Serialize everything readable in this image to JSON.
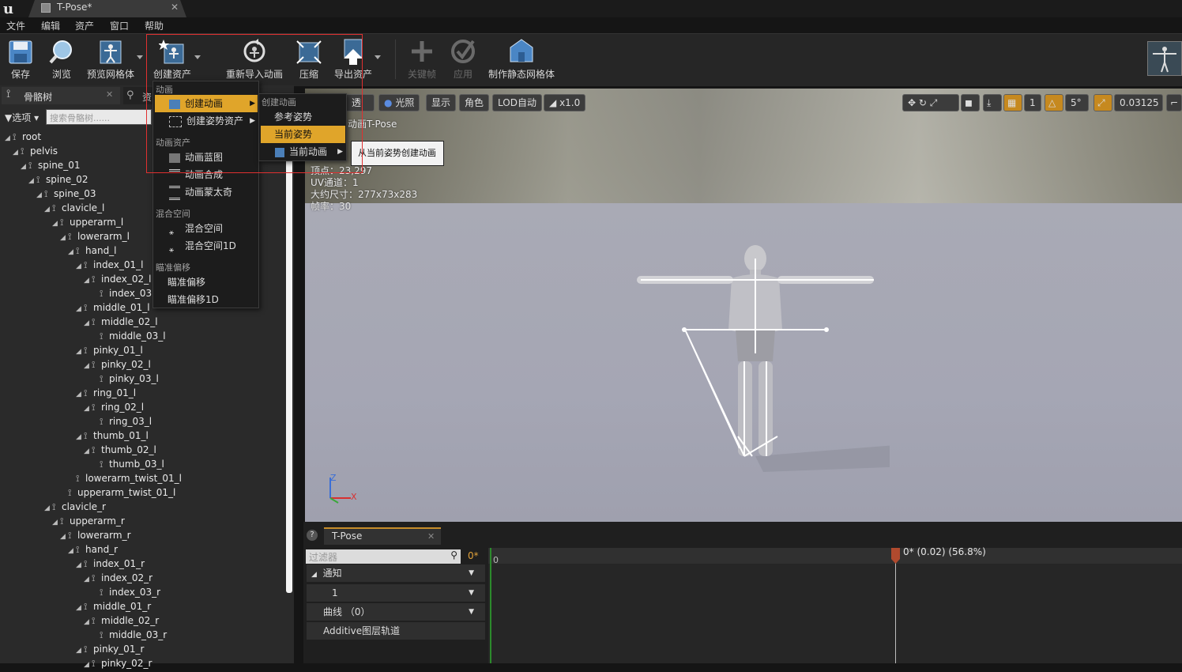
{
  "window": {
    "doc_tab": "T-Pose*"
  },
  "menubar": [
    "文件",
    "编辑",
    "资产",
    "窗口",
    "帮助"
  ],
  "toolbar": {
    "save": "保存",
    "browse": "浏览",
    "preview_mesh": "预览网格体",
    "create_asset": "创建资产",
    "reimport": "重新导入动画",
    "compress": "压缩",
    "export_asset": "导出资产",
    "keyframe": "关键帧",
    "apply": "应用",
    "make_static_mesh": "制作静态网格体"
  },
  "left_panel": {
    "tab_skeleton": "骨骼树",
    "tab_asset": "资",
    "options": "选项",
    "search_placeholder": "搜索骨骼树......",
    "bones": [
      {
        "name": "root",
        "depth": 0,
        "expand": true
      },
      {
        "name": "pelvis",
        "depth": 1,
        "expand": true
      },
      {
        "name": "spine_01",
        "depth": 2,
        "expand": true
      },
      {
        "name": "spine_02",
        "depth": 3,
        "expand": true
      },
      {
        "name": "spine_03",
        "depth": 4,
        "expand": true
      },
      {
        "name": "clavicle_l",
        "depth": 5,
        "expand": true
      },
      {
        "name": "upperarm_l",
        "depth": 6,
        "expand": true
      },
      {
        "name": "lowerarm_l",
        "depth": 7,
        "expand": true
      },
      {
        "name": "hand_l",
        "depth": 8,
        "expand": true
      },
      {
        "name": "index_01_l",
        "depth": 9,
        "expand": true
      },
      {
        "name": "index_02_l",
        "depth": 10,
        "expand": true
      },
      {
        "name": "index_03",
        "depth": 11,
        "expand": false
      },
      {
        "name": "middle_01_l",
        "depth": 9,
        "expand": true
      },
      {
        "name": "middle_02_l",
        "depth": 10,
        "expand": true
      },
      {
        "name": "middle_03_l",
        "depth": 11,
        "expand": false
      },
      {
        "name": "pinky_01_l",
        "depth": 9,
        "expand": true
      },
      {
        "name": "pinky_02_l",
        "depth": 10,
        "expand": true
      },
      {
        "name": "pinky_03_l",
        "depth": 11,
        "expand": false
      },
      {
        "name": "ring_01_l",
        "depth": 9,
        "expand": true
      },
      {
        "name": "ring_02_l",
        "depth": 10,
        "expand": true
      },
      {
        "name": "ring_03_l",
        "depth": 11,
        "expand": false
      },
      {
        "name": "thumb_01_l",
        "depth": 9,
        "expand": true
      },
      {
        "name": "thumb_02_l",
        "depth": 10,
        "expand": true
      },
      {
        "name": "thumb_03_l",
        "depth": 11,
        "expand": false
      },
      {
        "name": "lowerarm_twist_01_l",
        "depth": 8,
        "expand": false
      },
      {
        "name": "upperarm_twist_01_l",
        "depth": 7,
        "expand": false
      },
      {
        "name": "clavicle_r",
        "depth": 5,
        "expand": true
      },
      {
        "name": "upperarm_r",
        "depth": 6,
        "expand": true
      },
      {
        "name": "lowerarm_r",
        "depth": 7,
        "expand": true
      },
      {
        "name": "hand_r",
        "depth": 8,
        "expand": true
      },
      {
        "name": "index_01_r",
        "depth": 9,
        "expand": true
      },
      {
        "name": "index_02_r",
        "depth": 10,
        "expand": true
      },
      {
        "name": "index_03_r",
        "depth": 11,
        "expand": false
      },
      {
        "name": "middle_01_r",
        "depth": 9,
        "expand": true
      },
      {
        "name": "middle_02_r",
        "depth": 10,
        "expand": true
      },
      {
        "name": "middle_03_r",
        "depth": 11,
        "expand": false
      },
      {
        "name": "pinky_01_r",
        "depth": 9,
        "expand": true
      },
      {
        "name": "pinky_02_r",
        "depth": 10,
        "expand": true
      }
    ]
  },
  "viewport": {
    "perspective": "透视",
    "lit": "光照",
    "show": "显示",
    "character": "角色",
    "lod": "LOD自动",
    "speed": "x1.0",
    "snap_angle": "5°",
    "grid_count": "1",
    "scale_value": "0.03125",
    "info_anim": "动画T-Pose",
    "info_vertices": "顶点：23,297",
    "info_uv": "UV通道：1",
    "info_size": "大约尺寸：277x73x283",
    "info_fps": "帧率：30",
    "axis_z": "Z",
    "axis_x": "X"
  },
  "create_asset_menu": {
    "section_anim": "动画",
    "create_anim": "创建动画",
    "create_pose_asset": "创建姿势资产",
    "section_anim_asset": "动画资产",
    "anim_blueprint": "动画蓝图",
    "anim_composite": "动画合成",
    "anim_montage": "动画蒙太奇",
    "section_blend": "混合空间",
    "blend_space": "混合空间",
    "blend_space_1d": "混合空间1D",
    "section_aim": "瞄准偏移",
    "aim_offset": "瞄准偏移",
    "aim_offset_1d": "瞄准偏移1D"
  },
  "create_anim_submenu": {
    "section": "创建动画",
    "ref_pose": "参考姿势",
    "current_pose": "当前姿势",
    "current_anim": "当前动画"
  },
  "tooltip": "从当前姿势创建动画",
  "sequencer": {
    "tab": "T-Pose",
    "filter_placeholder": "过滤器",
    "frame": "0*",
    "tracks": [
      "通知",
      "1",
      "曲线 （0）",
      "Additive图层轨道"
    ],
    "ruler_start": "0",
    "playhead": "0* (0.02) (56.8%)"
  },
  "colors": {
    "accent": "#e0a52a",
    "highlight_border": "#e03030",
    "playhead": "#b04a2e"
  }
}
